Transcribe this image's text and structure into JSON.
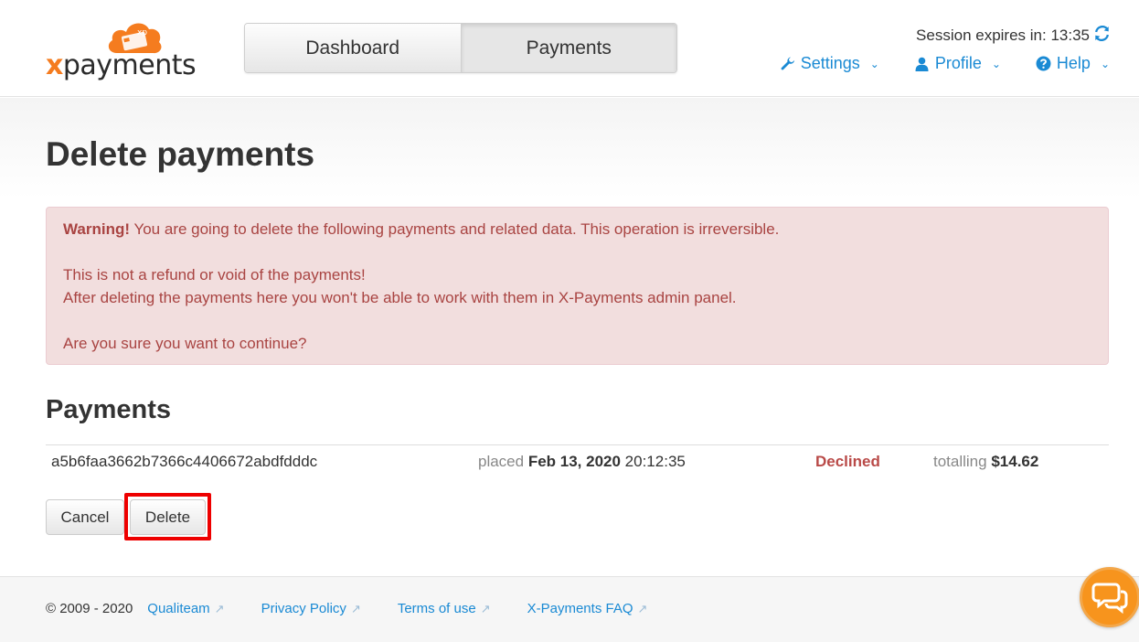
{
  "brand": {
    "logo_text_x": "x",
    "logo_text_rest": "payments",
    "logo_badge": "xp"
  },
  "nav": {
    "tabs": [
      {
        "label": "Dashboard"
      },
      {
        "label": "Payments"
      }
    ]
  },
  "session": {
    "label": "Session expires in: 13:35"
  },
  "toplinks": [
    {
      "label": "Settings"
    },
    {
      "label": "Profile"
    },
    {
      "label": "Help"
    }
  ],
  "page": {
    "title": "Delete payments"
  },
  "alert": {
    "strong": "Warning!",
    "line1": " You are going to delete the following payments and related data. This operation is irreversible.",
    "line2": "This is not a refund or void of the payments!",
    "line3": "After deleting the payments here you won't be able to work with them in X-Payments admin panel.",
    "line4": "Are you sure you want to continue?"
  },
  "payments": {
    "title": "Payments",
    "rows": [
      {
        "id": "a5b6faa3662b7366c4406672abdfdddc",
        "placed_prefix": "placed ",
        "placed_date": "Feb 13, 2020",
        "placed_time": " 20:12:35",
        "status": "Declined",
        "total_prefix": "totalling ",
        "total": "$14.62"
      }
    ]
  },
  "buttons": {
    "cancel": "Cancel",
    "delete": "Delete"
  },
  "footer": {
    "copyright": "© 2009 - 2020",
    "links": [
      {
        "label": "Qualiteam"
      },
      {
        "label": "Privacy Policy"
      },
      {
        "label": "Terms of use"
      },
      {
        "label": "X-Payments FAQ"
      }
    ]
  },
  "colors": {
    "accent": "#1a8ad4",
    "brand_orange": "#f57c1f",
    "danger_text": "#a94442",
    "alert_bg": "#f2dede",
    "highlight": "#ee0000"
  }
}
